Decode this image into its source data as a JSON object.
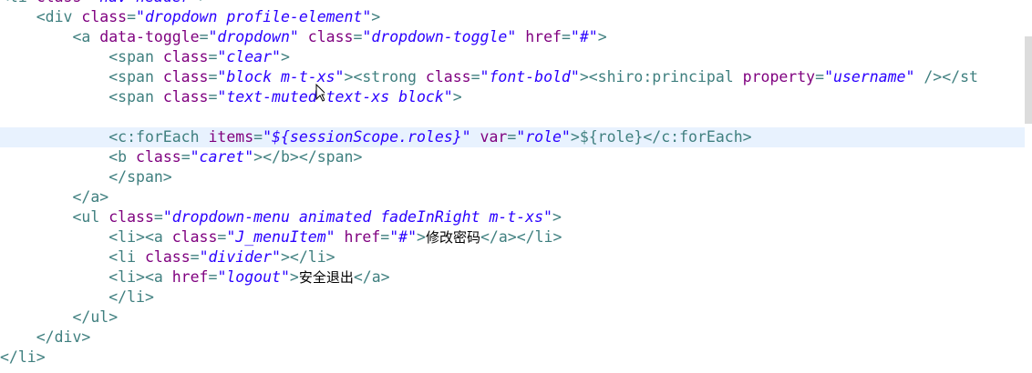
{
  "editor": {
    "lines": [
      {
        "segments": [
          [
            "t",
            "<li "
          ],
          [
            "a",
            "class"
          ],
          [
            "t",
            "="
          ],
          [
            "s",
            "\"nav-header\""
          ],
          [
            "t",
            ">"
          ]
        ]
      },
      {
        "segments": [
          [
            "t",
            "    <div "
          ],
          [
            "a",
            "class"
          ],
          [
            "t",
            "="
          ],
          [
            "s",
            "\"dropdown profile-element\""
          ],
          [
            "t",
            ">"
          ]
        ]
      },
      {
        "segments": [
          [
            "t",
            "        <a "
          ],
          [
            "a",
            "data-toggle"
          ],
          [
            "t",
            "="
          ],
          [
            "s",
            "\"dropdown\""
          ],
          [
            "t",
            " "
          ],
          [
            "a",
            "class"
          ],
          [
            "t",
            "="
          ],
          [
            "s",
            "\"dropdown-toggle\""
          ],
          [
            "t",
            " "
          ],
          [
            "a",
            "href"
          ],
          [
            "t",
            "="
          ],
          [
            "s",
            "\"#\""
          ],
          [
            "t",
            ">"
          ]
        ]
      },
      {
        "segments": [
          [
            "t",
            "            <span "
          ],
          [
            "a",
            "class"
          ],
          [
            "t",
            "="
          ],
          [
            "s",
            "\"clear\""
          ],
          [
            "t",
            ">"
          ]
        ]
      },
      {
        "segments": [
          [
            "t",
            "            <span "
          ],
          [
            "a",
            "class"
          ],
          [
            "t",
            "="
          ],
          [
            "s",
            "\"block m-t-xs\""
          ],
          [
            "t",
            ">"
          ],
          [
            "g",
            "<strong "
          ],
          [
            "a",
            "class"
          ],
          [
            "t",
            "="
          ],
          [
            "s",
            "\"font-bold\""
          ],
          [
            "t",
            ">"
          ],
          [
            "g",
            "<shiro:principal "
          ],
          [
            "a",
            "property"
          ],
          [
            "t",
            "="
          ],
          [
            "s",
            "\"username\""
          ],
          [
            "g",
            " /></st"
          ]
        ]
      },
      {
        "segments": [
          [
            "t",
            "            <span "
          ],
          [
            "a",
            "class"
          ],
          [
            "t",
            "="
          ],
          [
            "s",
            "\"text-muted text-xs block\""
          ],
          [
            "t",
            ">"
          ]
        ]
      },
      {
        "segments": [
          [
            "t",
            ""
          ]
        ]
      },
      {
        "current": true,
        "segments": [
          [
            "g",
            "            <c:forEach "
          ],
          [
            "a",
            "items"
          ],
          [
            "t",
            "="
          ],
          [
            "s",
            "\"${sessionScope.roles}\""
          ],
          [
            "t",
            " "
          ],
          [
            "a",
            "var"
          ],
          [
            "t",
            "="
          ],
          [
            "s",
            "\"role\""
          ],
          [
            "g",
            ">"
          ],
          [
            "t",
            "${role}"
          ],
          [
            "g",
            "</c:forEach>"
          ]
        ]
      },
      {
        "segments": [
          [
            "g",
            "            <b "
          ],
          [
            "a",
            "class"
          ],
          [
            "t",
            "="
          ],
          [
            "s",
            "\"caret\""
          ],
          [
            "g",
            "></b></span>"
          ]
        ]
      },
      {
        "segments": [
          [
            "g",
            "            </span>"
          ]
        ]
      },
      {
        "segments": [
          [
            "g",
            "        </a>"
          ]
        ]
      },
      {
        "segments": [
          [
            "g",
            "        <ul "
          ],
          [
            "a",
            "class"
          ],
          [
            "t",
            "="
          ],
          [
            "s",
            "\"dropdown-menu animated fadeInRight m-t-xs\""
          ],
          [
            "g",
            ">"
          ]
        ]
      },
      {
        "segments": [
          [
            "g",
            "            <li><a "
          ],
          [
            "a",
            "class"
          ],
          [
            "t",
            "="
          ],
          [
            "s",
            "\"J_menuItem\""
          ],
          [
            "t",
            " "
          ],
          [
            "a",
            "href"
          ],
          [
            "t",
            "="
          ],
          [
            "s",
            "\"#\""
          ],
          [
            "g",
            ">"
          ],
          [
            "c",
            "修改密码"
          ],
          [
            "g",
            "</a></li>"
          ]
        ]
      },
      {
        "segments": [
          [
            "g",
            "            <li "
          ],
          [
            "a",
            "class"
          ],
          [
            "t",
            "="
          ],
          [
            "s",
            "\"divider\""
          ],
          [
            "g",
            "></li>"
          ]
        ]
      },
      {
        "segments": [
          [
            "g",
            "            <li><a "
          ],
          [
            "a",
            "href"
          ],
          [
            "t",
            "="
          ],
          [
            "s",
            "\"logout\""
          ],
          [
            "g",
            ">"
          ],
          [
            "c",
            "安全退出"
          ],
          [
            "g",
            "</a>"
          ]
        ]
      },
      {
        "segments": [
          [
            "g",
            "            </li>"
          ]
        ]
      },
      {
        "segments": [
          [
            "g",
            "        </ul>"
          ]
        ]
      },
      {
        "segments": [
          [
            "g",
            "    </div>"
          ]
        ]
      },
      {
        "segments": [
          [
            "g",
            "</li>"
          ]
        ]
      }
    ]
  },
  "colors": {
    "tag": "#3f7f7f",
    "attribute": "#7f007f",
    "string": "#2a00ff",
    "text": "#000000",
    "current_line": "#e8f2fe"
  },
  "icons": {
    "cursor": "text-ibeam-cursor-icon"
  }
}
